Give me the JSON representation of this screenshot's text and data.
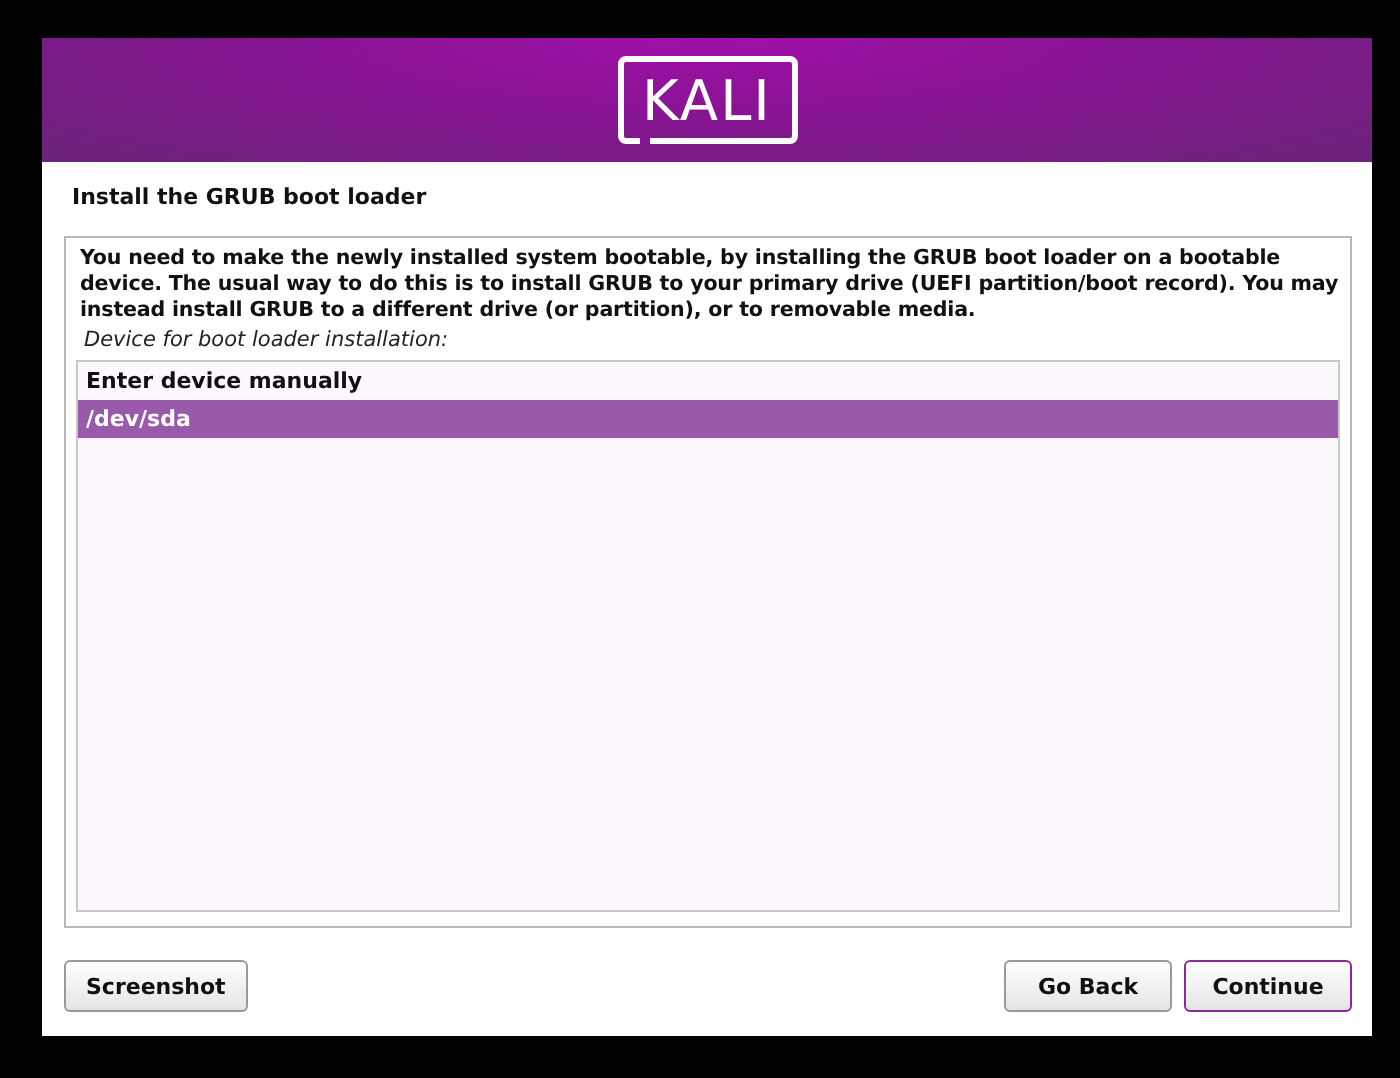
{
  "banner": {
    "logo": "KALI"
  },
  "page_title": "Install the GRUB boot loader",
  "description": "You need to make the newly installed system bootable, by installing the GRUB boot loader on a bootable device. The usual way to do this is to install GRUB to your primary drive (UEFI partition/boot record). You may instead install GRUB to a different drive (or partition), or to removable media.",
  "prompt": "Device for boot loader installation:",
  "options": [
    {
      "label": "Enter device manually",
      "selected": false
    },
    {
      "label": "/dev/sda",
      "selected": true
    }
  ],
  "left_buttons": [
    {
      "label": "Screenshot",
      "focused": false
    }
  ],
  "right_buttons": [
    {
      "label": "Go Back",
      "focused": false
    },
    {
      "label": "Continue",
      "focused": true
    }
  ]
}
